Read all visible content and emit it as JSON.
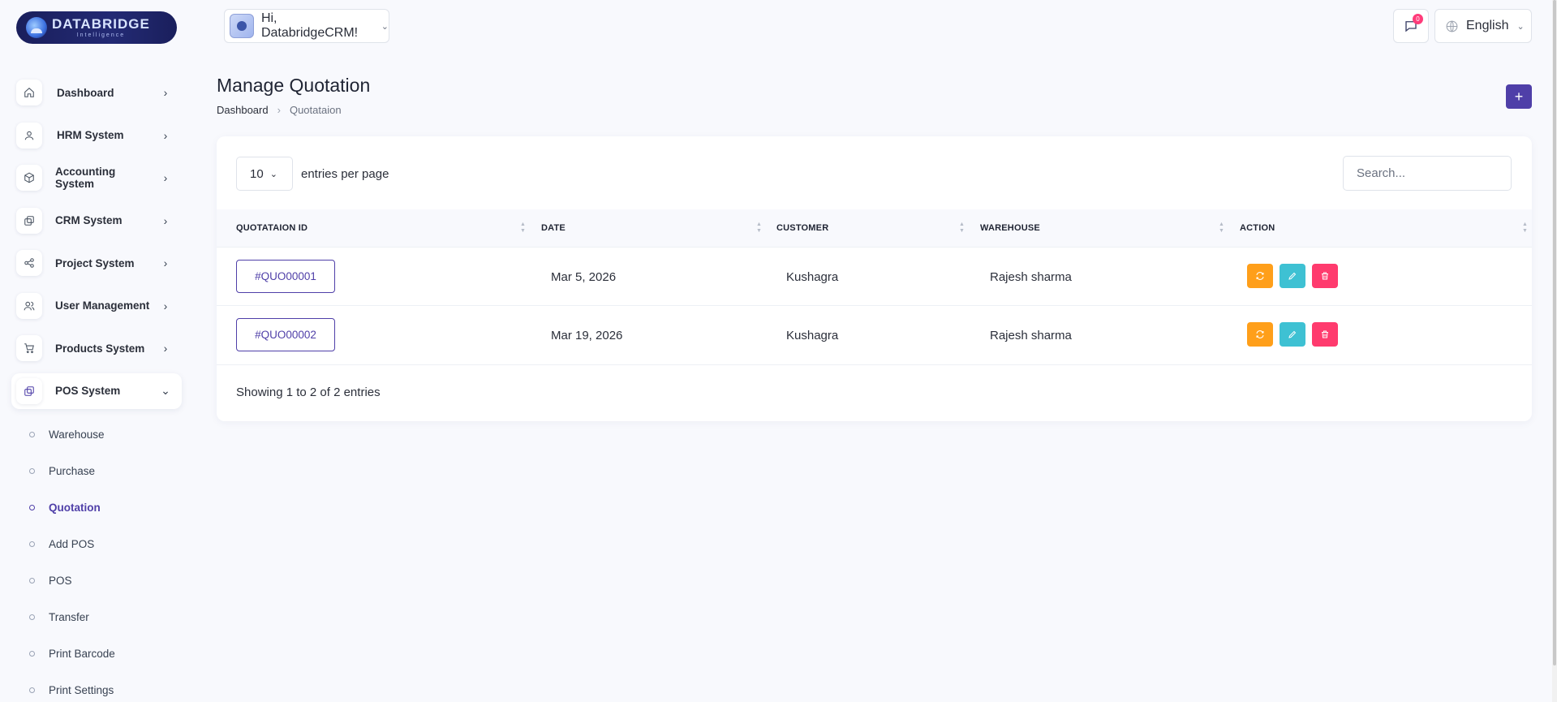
{
  "logo": {
    "title": "DATABRIDGE",
    "subtitle": "Intelligence"
  },
  "header": {
    "greeting": "Hi, DatabridgeCRM!",
    "notification_count": "0",
    "language": "English"
  },
  "sidebar": {
    "items": [
      {
        "label": "Dashboard",
        "icon": "home-icon"
      },
      {
        "label": "HRM System",
        "icon": "user-icon"
      },
      {
        "label": "Accounting System",
        "icon": "box-icon"
      },
      {
        "label": "CRM System",
        "icon": "layers-icon"
      },
      {
        "label": "Project System",
        "icon": "share-icon"
      },
      {
        "label": "User Management",
        "icon": "users-icon"
      },
      {
        "label": "Products System",
        "icon": "cart-icon"
      },
      {
        "label": "POS System",
        "icon": "layers-icon"
      }
    ],
    "pos_sub": [
      {
        "label": "Warehouse"
      },
      {
        "label": "Purchase"
      },
      {
        "label": "Quotation"
      },
      {
        "label": "Add POS"
      },
      {
        "label": "POS"
      },
      {
        "label": "Transfer"
      },
      {
        "label": "Print Barcode"
      },
      {
        "label": "Print Settings"
      }
    ]
  },
  "page": {
    "title": "Manage Quotation",
    "breadcrumb_home": "Dashboard",
    "breadcrumb_current": "Quotataion",
    "add_label": "+"
  },
  "table": {
    "entries_value": "10",
    "entries_label": "entries per page",
    "search_placeholder": "Search...",
    "headers": [
      "QUOTATAION ID",
      "DATE",
      "CUSTOMER",
      "WAREHOUSE",
      "ACTION"
    ],
    "rows": [
      {
        "id": "#QUO00001",
        "date": "Mar 5, 2026",
        "customer": "Kushagra",
        "warehouse": "Rajesh sharma"
      },
      {
        "id": "#QUO00002",
        "date": "Mar 19, 2026",
        "customer": "Kushagra",
        "warehouse": "Rajesh sharma"
      }
    ],
    "footer": "Showing 1 to 2 of 2 entries"
  },
  "colors": {
    "accent": "#4f3fa8",
    "convert": "#ff9f1a",
    "edit": "#3ec1d3",
    "delete": "#ff3b6e"
  }
}
